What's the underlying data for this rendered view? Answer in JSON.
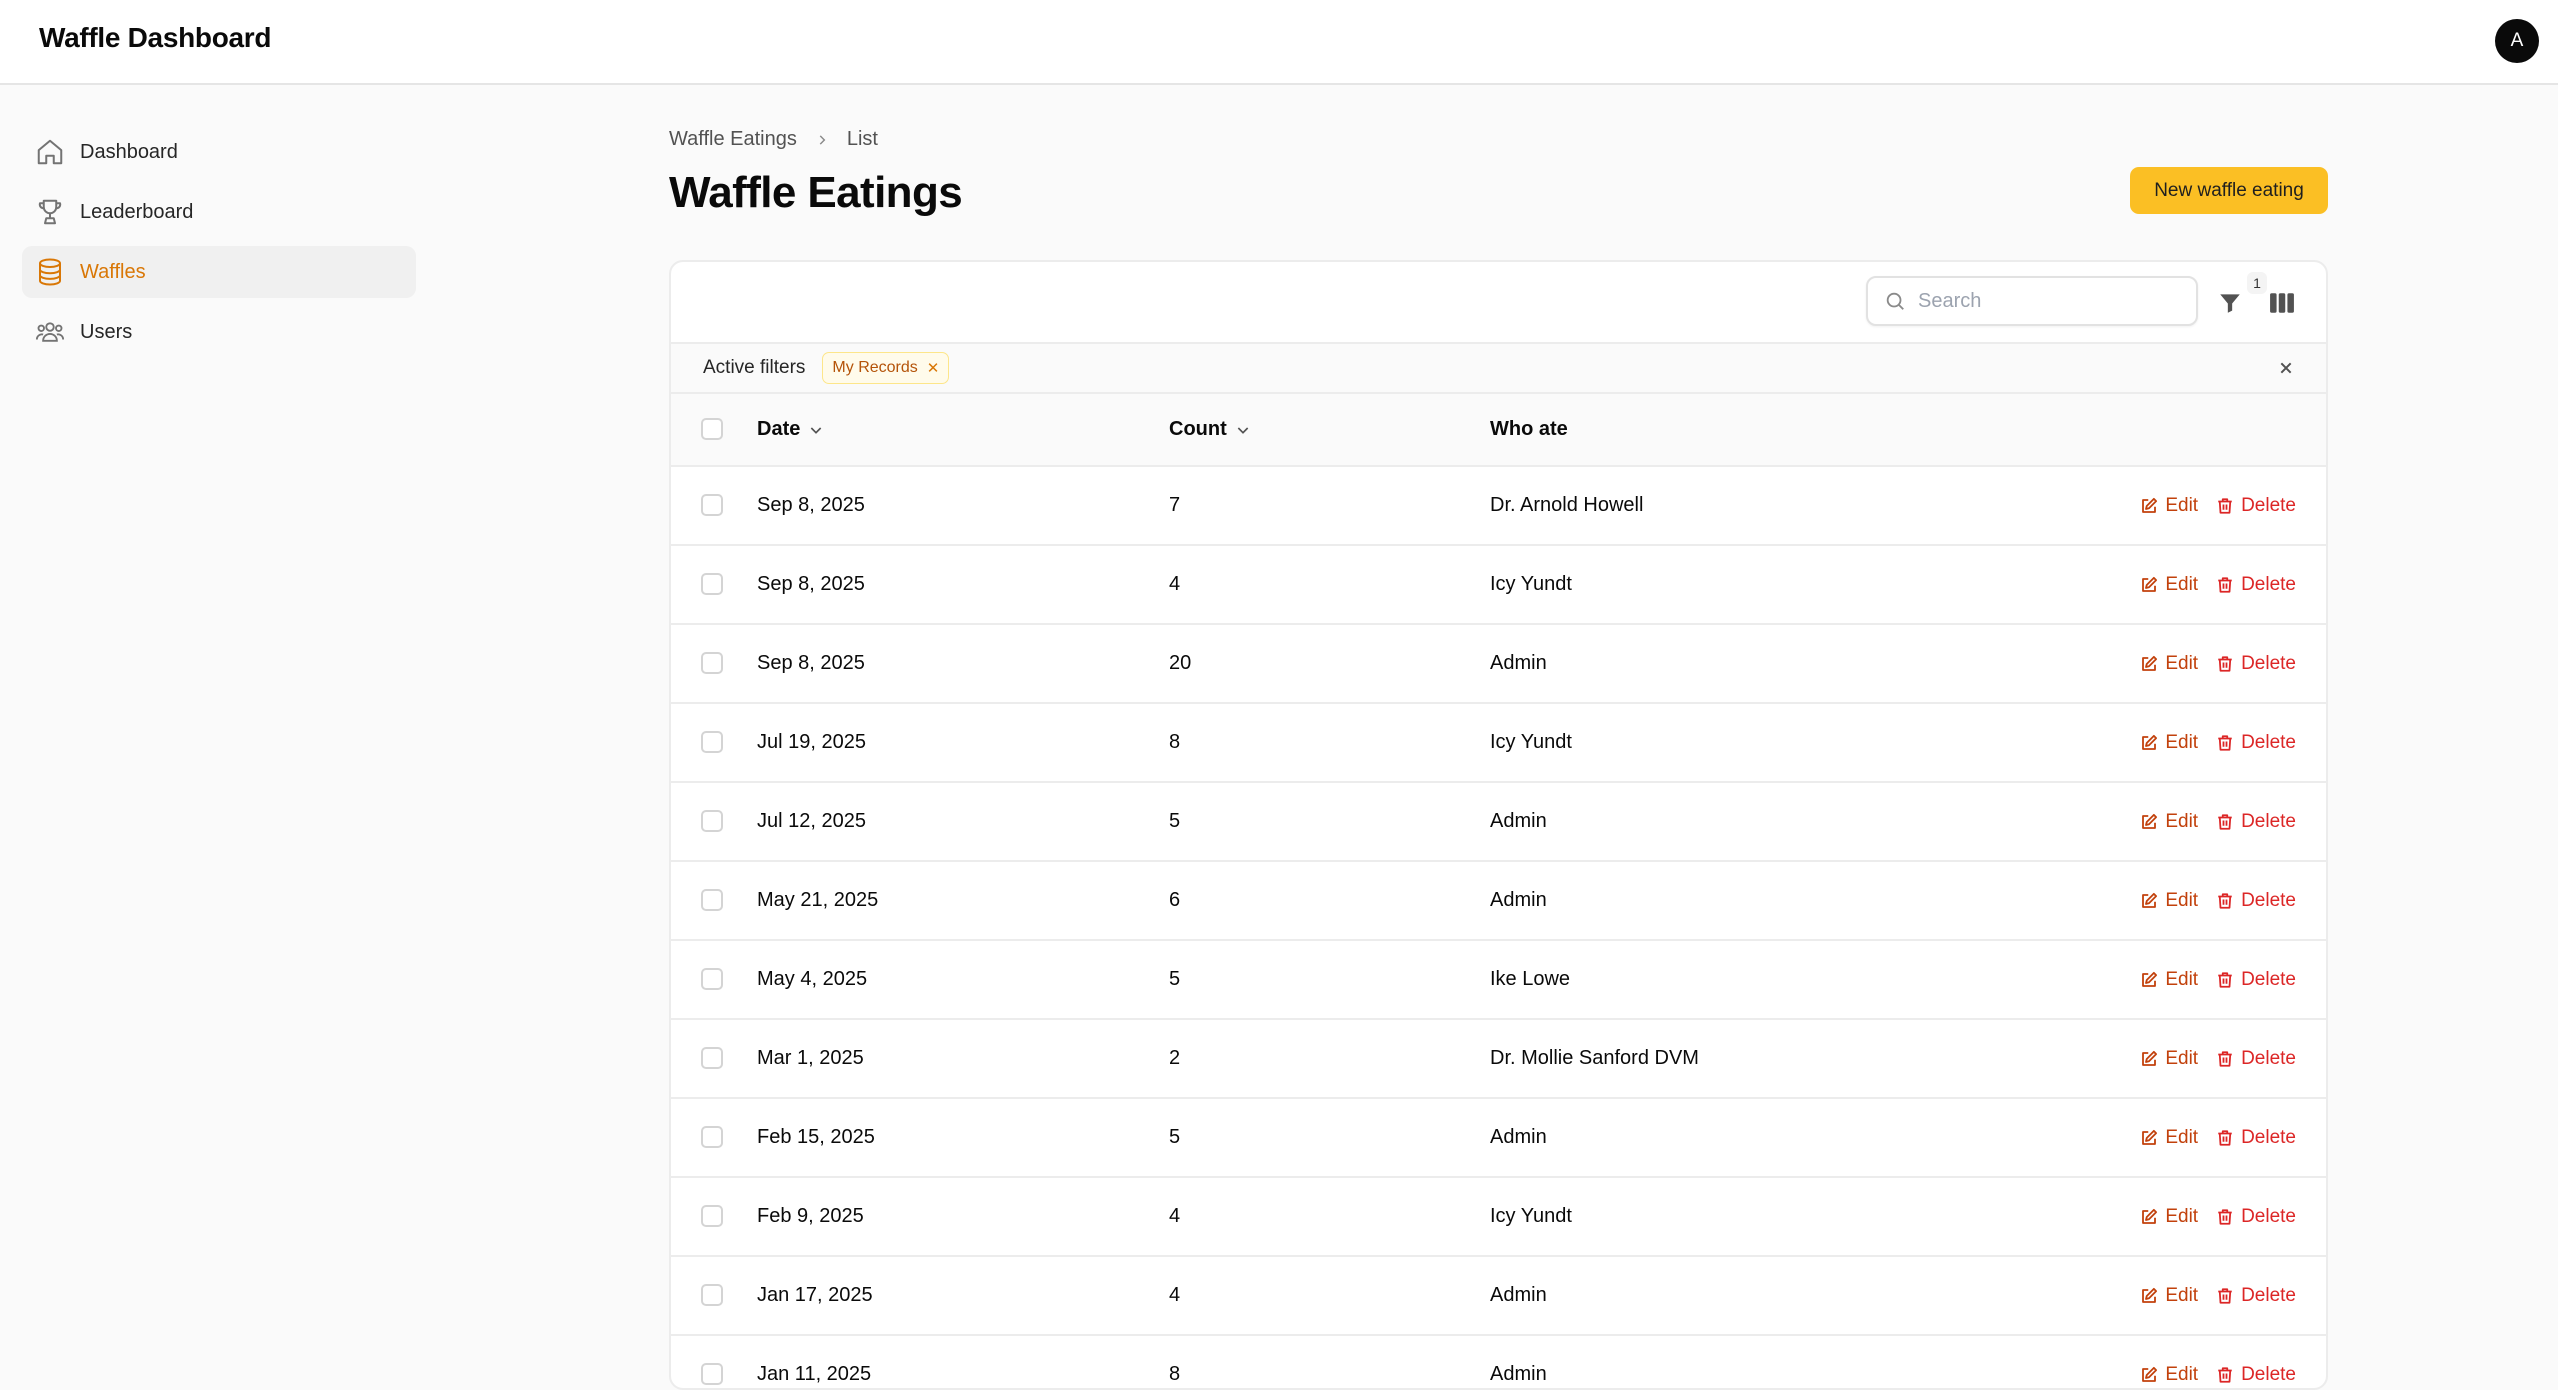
{
  "app": {
    "title": "Waffle Dashboard",
    "avatar_initial": "A"
  },
  "sidebar": {
    "items": [
      {
        "label": "Dashboard",
        "icon": "home-icon",
        "active": false
      },
      {
        "label": "Leaderboard",
        "icon": "trophy-icon",
        "active": false
      },
      {
        "label": "Waffles",
        "icon": "database-icon",
        "active": true
      },
      {
        "label": "Users",
        "icon": "users-icon",
        "active": false
      }
    ]
  },
  "breadcrumb": {
    "parent": "Waffle Eatings",
    "current": "List"
  },
  "page": {
    "title": "Waffle Eatings",
    "new_button": "New waffle eating"
  },
  "toolbar": {
    "search_placeholder": "Search",
    "filter_count": "1"
  },
  "active_filters": {
    "label": "Active filters",
    "chips": [
      "My Records"
    ]
  },
  "table": {
    "columns": {
      "date": "Date",
      "count": "Count",
      "who": "Who ate"
    },
    "actions": {
      "edit": "Edit",
      "delete": "Delete"
    },
    "rows": [
      {
        "date": "Sep 8, 2025",
        "count": "7",
        "who": "Dr. Arnold Howell"
      },
      {
        "date": "Sep 8, 2025",
        "count": "4",
        "who": "Icy Yundt"
      },
      {
        "date": "Sep 8, 2025",
        "count": "20",
        "who": "Admin"
      },
      {
        "date": "Jul 19, 2025",
        "count": "8",
        "who": "Icy Yundt"
      },
      {
        "date": "Jul 12, 2025",
        "count": "5",
        "who": "Admin"
      },
      {
        "date": "May 21, 2025",
        "count": "6",
        "who": "Admin"
      },
      {
        "date": "May 4, 2025",
        "count": "5",
        "who": "Ike Lowe"
      },
      {
        "date": "Mar 1, 2025",
        "count": "2",
        "who": "Dr. Mollie Sanford DVM"
      },
      {
        "date": "Feb 15, 2025",
        "count": "5",
        "who": "Admin"
      },
      {
        "date": "Feb 9, 2025",
        "count": "4",
        "who": "Icy Yundt"
      },
      {
        "date": "Jan 17, 2025",
        "count": "4",
        "who": "Admin"
      },
      {
        "date": "Jan 11, 2025",
        "count": "8",
        "who": "Admin"
      }
    ]
  },
  "colors": {
    "accent": "#d97706",
    "primary_button": "#fbbf24",
    "edit": "#c2410c",
    "delete": "#dc2626"
  }
}
